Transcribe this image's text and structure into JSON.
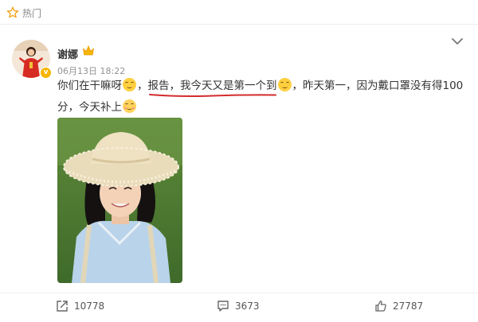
{
  "header": {
    "hot_label": "热门"
  },
  "post": {
    "username": "谢娜",
    "timestamp": "06月13日 18:22",
    "verified_badge": "v",
    "text_part1": "你们在干嘛呀",
    "text_part2": "，报告，我今天又是第一个到",
    "text_part3": "，昨天第一，因为戴口罩没有得100分，今天补上",
    "icons": {
      "hot": "hot-star-icon",
      "crown": "crown-icon",
      "more": "chevron-down-icon",
      "repost": "repost-icon",
      "comment": "comment-icon",
      "like": "thumbs-up-icon"
    }
  },
  "actions": {
    "repost_count": "10778",
    "comment_count": "3673",
    "like_count": "27787"
  },
  "colors": {
    "annotation_underline": "#d42c2c",
    "hot_icon": "#f5a623",
    "badge": "#f7b500"
  }
}
